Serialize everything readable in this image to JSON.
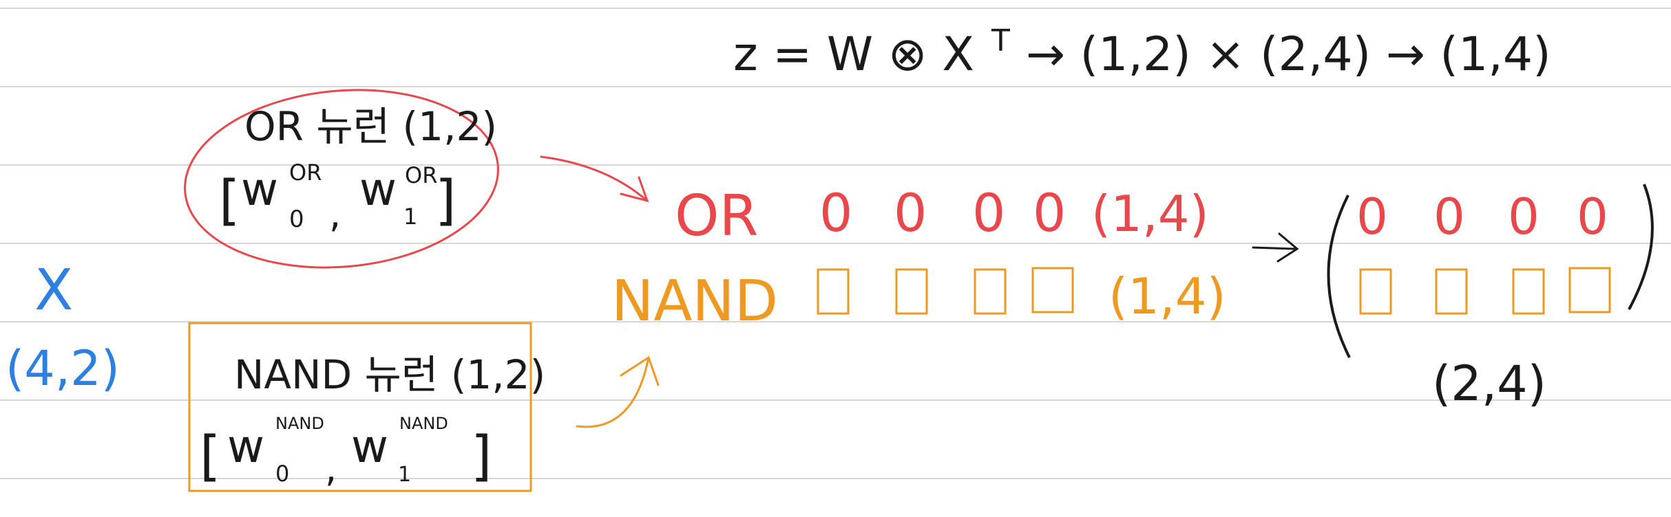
{
  "formula": {
    "text": "z = W ⊗ X",
    "sup": "T",
    "shapes": "→ (1,2) × (2,4) → (1,4)"
  },
  "x_input": {
    "label": "X",
    "shape": "(4,2)"
  },
  "or_neuron": {
    "title": "OR 뉴런 (1,2)",
    "w_open": "[",
    "w0": "w",
    "w0_sub": "0",
    "w0_sup": "OR",
    "sep": ",",
    "w1": "w",
    "w1_sub": "1",
    "w1_sup": "OR",
    "w_close": "]"
  },
  "nand_neuron": {
    "title": "NAND 뉴런 (1,2)",
    "w_open": "[",
    "w0": "w",
    "w0_sub": "0",
    "w0_sup": "NAND",
    "sep": ",",
    "w1": "w",
    "w1_sub": "1",
    "w1_sup": "NAND",
    "w_close": "]"
  },
  "or_row": {
    "label": "OR",
    "cells": [
      "0",
      "0",
      "0",
      "0"
    ],
    "shape": "(1,4)"
  },
  "nand_row": {
    "label": "NAND",
    "shape": "(1,4)"
  },
  "result": {
    "row1": [
      "0",
      "0",
      "0",
      "0"
    ],
    "shape": "(2,4)"
  },
  "colors": {
    "ink": "#1a1a1a",
    "red": "#e8474b",
    "orange": "#ee9a22",
    "blue": "#2d7fe0",
    "rule": "#d6d6d6"
  }
}
